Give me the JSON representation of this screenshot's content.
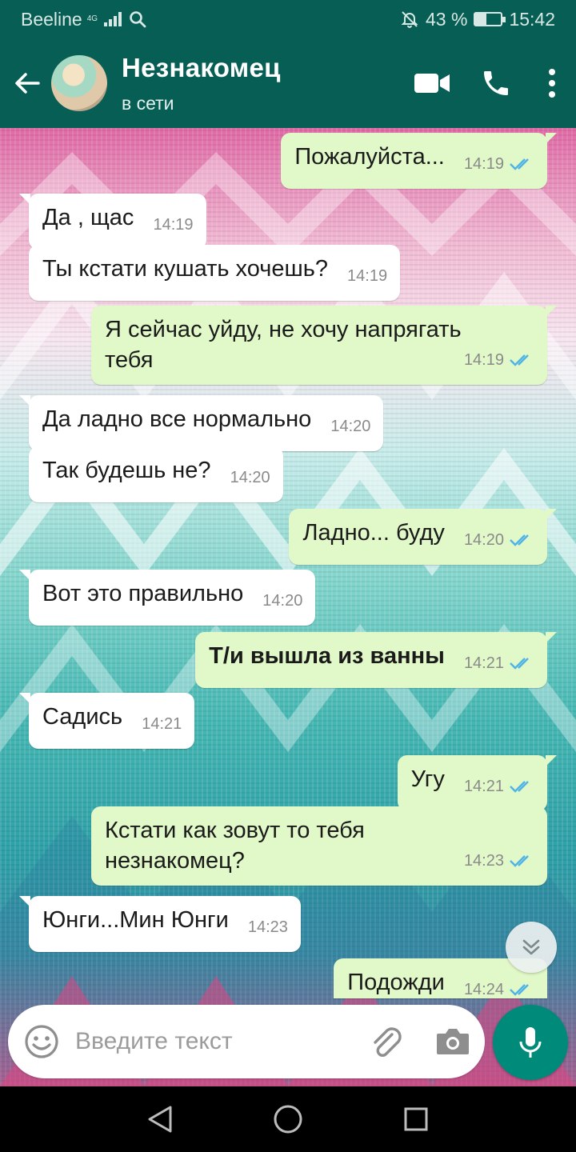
{
  "status_bar": {
    "carrier": "Beeline",
    "network": "4G",
    "battery_percent": "43 %",
    "time": "15:42"
  },
  "header": {
    "contact_name": "Незнакомец",
    "contact_status": "в сети",
    "icons": [
      "back-arrow-icon",
      "video-call-icon",
      "phone-call-icon",
      "more-vert-icon"
    ]
  },
  "messages": [
    {
      "dir": "out",
      "text": "Пожалуйста...",
      "time": "14:19",
      "read": true
    },
    {
      "dir": "in",
      "text": "Да , щас",
      "time": "14:19"
    },
    {
      "dir": "in",
      "text": "Ты кстати кушать хочешь?",
      "time": "14:19"
    },
    {
      "dir": "out",
      "text_line1": "Я сейчас уйду, не хочу напрягать",
      "text_line2": "тебя",
      "time": "14:19",
      "read": true
    },
    {
      "dir": "in",
      "text": "Да ладно все нормально",
      "time": "14:20"
    },
    {
      "dir": "in",
      "text": "Так будешь не?",
      "time": "14:20"
    },
    {
      "dir": "out",
      "text": "Ладно... буду",
      "time": "14:20",
      "read": true
    },
    {
      "dir": "in",
      "text": "Вот это правильно",
      "time": "14:20"
    },
    {
      "dir": "out",
      "text": "Т/и вышла из ванны",
      "time": "14:21",
      "read": true,
      "bold": true
    },
    {
      "dir": "in",
      "text": "Садись",
      "time": "14:21"
    },
    {
      "dir": "out",
      "text": "Угу",
      "time": "14:21",
      "read": true
    },
    {
      "dir": "out",
      "text_line1": "Кстати как зовут то тебя",
      "text_line2": "незнакомец?",
      "time": "14:23",
      "read": true
    },
    {
      "dir": "in",
      "text": "Юнги...Мин Юнги",
      "time": "14:23"
    },
    {
      "dir": "out",
      "text": "Подожди",
      "time": "14:24",
      "read": true
    }
  ],
  "input": {
    "placeholder": "Введите текст",
    "icons": [
      "emoji-icon",
      "attach-icon",
      "camera-icon",
      "mic-icon"
    ]
  },
  "colors": {
    "header": "#075e54",
    "outgoing_bubble": "#e1f8c8",
    "incoming_bubble": "#ffffff",
    "read_ticks": "#4fb3e8",
    "mic_button": "#008a7a"
  }
}
